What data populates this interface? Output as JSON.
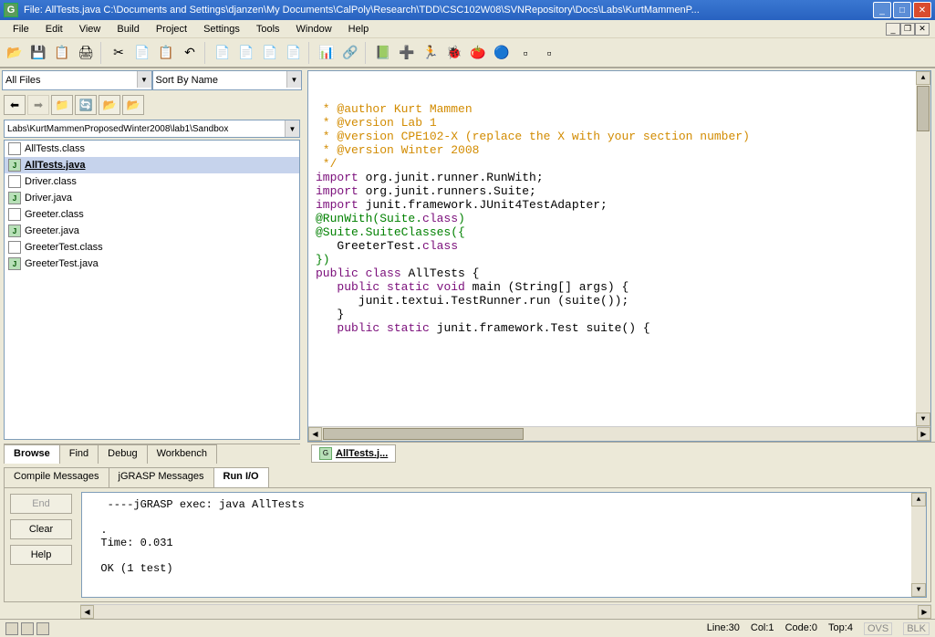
{
  "title": "File:  AllTests.java  C:\\Documents and Settings\\djanzen\\My Documents\\CalPoly\\Research\\TDD\\CSC102W08\\SVNRepository\\Docs\\Labs\\KurtMammenP...",
  "menu": [
    "File",
    "Edit",
    "View",
    "Build",
    "Project",
    "Settings",
    "Tools",
    "Window",
    "Help"
  ],
  "toolbar_icons": [
    "📂",
    "💾",
    "📋",
    "🖨",
    "✂",
    "📄",
    "📋",
    "↶",
    "📄",
    "📄",
    "📄",
    "📄",
    "📊",
    "🔗",
    "📗",
    "➕",
    "🏃",
    "🐞",
    "🍅",
    "🔵",
    "▫",
    "▫"
  ],
  "filter": "All Files",
  "sort": "Sort By Name",
  "path": "Labs\\KurtMammenProposedWinter2008\\lab1\\Sandbox",
  "files": [
    {
      "name": "AllTests.class",
      "type": "class"
    },
    {
      "name": "AllTests.java",
      "type": "java",
      "selected": true
    },
    {
      "name": "Driver.class",
      "type": "class"
    },
    {
      "name": "Driver.java",
      "type": "java"
    },
    {
      "name": "Greeter.class",
      "type": "class"
    },
    {
      "name": "Greeter.java",
      "type": "java"
    },
    {
      "name": "GreeterTest.class",
      "type": "class"
    },
    {
      "name": "GreeterTest.java",
      "type": "java"
    }
  ],
  "left_tabs": [
    "Browse",
    "Find",
    "Debug",
    "Workbench"
  ],
  "left_active": "Browse",
  "editor_tab": "AllTests.j...",
  "code_lines": [
    {
      "segs": [
        {
          "t": " * @author Kurt Mammen",
          "c": "cmt"
        }
      ]
    },
    {
      "segs": [
        {
          "t": " * @version Lab 1",
          "c": "cmt"
        }
      ]
    },
    {
      "segs": [
        {
          "t": " * @version CPE102-X (replace the X with your section number)",
          "c": "cmt"
        }
      ]
    },
    {
      "segs": [
        {
          "t": " * @version Winter 2008",
          "c": "cmt"
        }
      ]
    },
    {
      "segs": [
        {
          "t": " */",
          "c": "cmt"
        }
      ]
    },
    {
      "segs": [
        {
          "t": ""
        }
      ]
    },
    {
      "segs": [
        {
          "t": "import",
          "c": "kw-p"
        },
        {
          "t": " org.junit.runner.RunWith;"
        }
      ]
    },
    {
      "segs": [
        {
          "t": "import",
          "c": "kw-p"
        },
        {
          "t": " org.junit.runners.Suite;"
        }
      ]
    },
    {
      "segs": [
        {
          "t": "import",
          "c": "kw-p"
        },
        {
          "t": " junit.framework.JUnit4TestAdapter;"
        }
      ]
    },
    {
      "segs": [
        {
          "t": ""
        }
      ]
    },
    {
      "segs": [
        {
          "t": "@RunWith(Suite.",
          "c": "kw-g"
        },
        {
          "t": "class",
          "c": "kw-p"
        },
        {
          "t": ")",
          "c": "kw-g"
        }
      ]
    },
    {
      "segs": [
        {
          "t": "@Suite.SuiteClasses({",
          "c": "kw-g"
        }
      ]
    },
    {
      "segs": [
        {
          "t": "   GreeterTest."
        },
        {
          "t": "class",
          "c": "kw-p"
        }
      ]
    },
    {
      "segs": [
        {
          "t": "})",
          "c": "kw-g"
        }
      ]
    },
    {
      "segs": [
        {
          "t": ""
        }
      ]
    },
    {
      "segs": [
        {
          "t": "public",
          "c": "kw-p"
        },
        {
          "t": " "
        },
        {
          "t": "class",
          "c": "kw-p"
        },
        {
          "t": " AllTests {"
        }
      ]
    },
    {
      "segs": [
        {
          "t": ""
        }
      ]
    },
    {
      "segs": [
        {
          "t": "   "
        },
        {
          "t": "public",
          "c": "kw-p"
        },
        {
          "t": " "
        },
        {
          "t": "static",
          "c": "kw-p"
        },
        {
          "t": " "
        },
        {
          "t": "void",
          "c": "kw-p"
        },
        {
          "t": " main (String[] args) {"
        }
      ]
    },
    {
      "segs": [
        {
          "t": "      junit.textui.TestRunner.run (suite());"
        }
      ]
    },
    {
      "segs": [
        {
          "t": "   }"
        }
      ]
    },
    {
      "segs": [
        {
          "t": ""
        }
      ]
    },
    {
      "segs": [
        {
          "t": "   "
        },
        {
          "t": "public",
          "c": "kw-p"
        },
        {
          "t": " "
        },
        {
          "t": "static",
          "c": "kw-p"
        },
        {
          "t": " junit.framework.Test suite() {"
        }
      ]
    }
  ],
  "bottom_tabs": [
    "Compile Messages",
    "jGRASP Messages",
    "Run I/O"
  ],
  "bottom_active": "Run I/O",
  "out_btns": [
    {
      "label": "End",
      "disabled": true
    },
    {
      "label": "Clear",
      "disabled": false
    },
    {
      "label": "Help",
      "disabled": false
    }
  ],
  "console": "   ----jGRASP exec: java AllTests\n\n  .\n  Time: 0.031\n\n  OK (1 test)\n",
  "status": {
    "line": "Line:30",
    "col": "Col:1",
    "code": "Code:0",
    "top": "Top:4",
    "ovs": "OVS",
    "blk": "BLK"
  }
}
